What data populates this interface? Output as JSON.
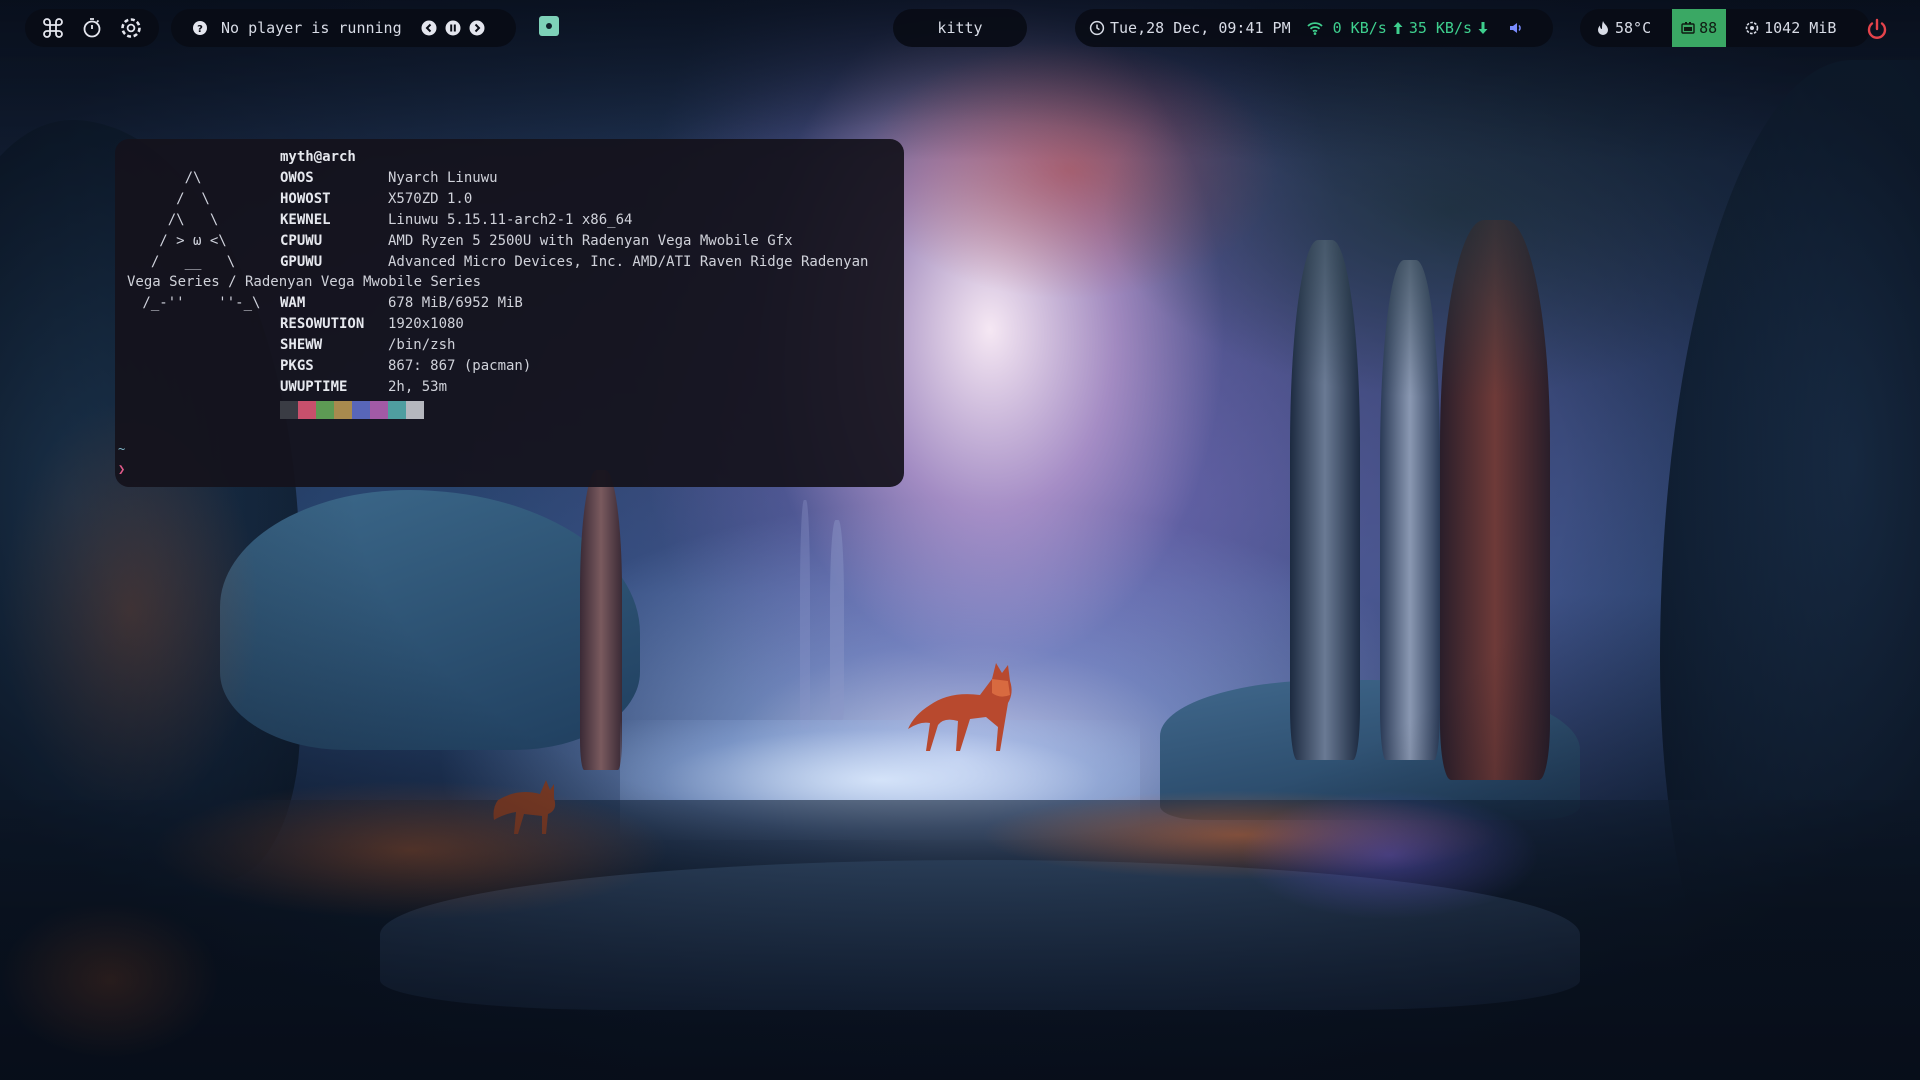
{
  "topbar": {
    "left_icons": [
      "command-icon",
      "timer-icon",
      "settings-icon"
    ],
    "media": {
      "status": "No player is running",
      "icons": [
        "player-info-icon",
        "previous-track-icon",
        "play-pause-icon",
        "next-track-icon"
      ]
    },
    "workspace_icon": "workspace-icon",
    "window_title": "kitty",
    "clock": "Tue,28 Dec, 09:41 PM",
    "net_down": "0 KB/s",
    "net_up": "35 KB/s",
    "temperature": "58°C",
    "battery": "88",
    "memory": "1042 MiB",
    "colors": {
      "pill_bg": "#0a0d16",
      "net_green": "#3ecf8e",
      "battery_bg": "#3aa864",
      "power_red": "#e5434b"
    }
  },
  "terminal": {
    "user_host": "myth@arch",
    "fields": [
      {
        "key": "OWOS",
        "value": "Nyarch Linuwu"
      },
      {
        "key": "HOWOST",
        "value": "X570ZD 1.0"
      },
      {
        "key": "KEWNEL",
        "value": "Linuwu 5.15.11-arch2-1 x86_64"
      },
      {
        "key": "CPUWU",
        "value": "AMD Ryzen 5 2500U with Radenyan Vega Mwobile Gfx"
      },
      {
        "key": "GPUWU",
        "value": "Advanced Micro Devices, Inc. AMD/ATI Raven Ridge Radenyan"
      },
      {
        "key": "WAM",
        "value": "678 MiB/6952 MiB"
      },
      {
        "key": "RESOWUTION",
        "value": "1920x1080"
      },
      {
        "key": "SHEWW",
        "value": "/bin/zsh"
      },
      {
        "key": "PKGS",
        "value": "867: 867 (pacman)"
      },
      {
        "key": "UWUPTIME",
        "value": "2h, 53m"
      }
    ],
    "gpu_wrap": "Vega Series / Radenyan Vega Mwobile Series",
    "ascii_logo": [
      "      /\\",
      "     /  \\",
      "    /\\   \\",
      "   / > ω <\\",
      "  /   __   \\",
      " /_-''    ''-_\\"
    ],
    "palette": [
      "#3a3c44",
      "#c8506c",
      "#5d9a54",
      "#a88a4e",
      "#5866b8",
      "#a25aa6",
      "#4f9ea0",
      "#b5b7be"
    ],
    "prompt_dir": "~",
    "prompt_symbol": "❯",
    "colors": {
      "background": "#14121c",
      "text": "#d0d2da",
      "prompt_dir": "#7fb7c9",
      "prompt_symbol": "#e05a8a"
    }
  }
}
